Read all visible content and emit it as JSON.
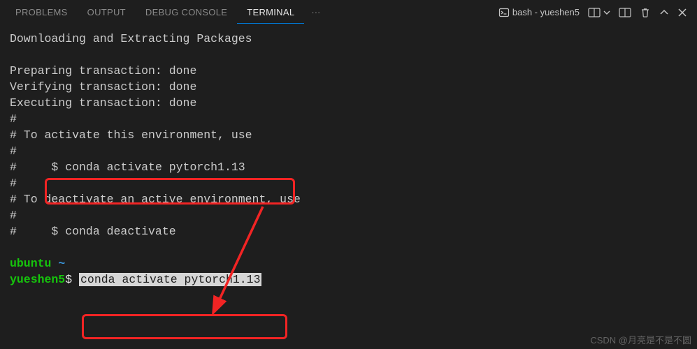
{
  "tabs": {
    "problems": "PROBLEMS",
    "output": "OUTPUT",
    "debug_console": "DEBUG CONSOLE",
    "terminal": "TERMINAL",
    "more": "···"
  },
  "toolbar": {
    "shell_label": "bash - yueshen5"
  },
  "term": {
    "l1": "Downloading and Extracting Packages",
    "l2": "",
    "l3": "Preparing transaction: done",
    "l4": "Verifying transaction: done",
    "l5": "Executing transaction: done",
    "l6": "#",
    "l7": "# To activate this environment, use",
    "l8": "#",
    "l9a": "#     ",
    "l9b": "$ conda activate pytorch1.13",
    "l10": "#",
    "l11": "# To deactivate an active environment, use",
    "l12": "#",
    "l13": "#     $ conda deactivate",
    "l14": "",
    "host1": "ubuntu",
    "path1": " ~",
    "host2": "yueshen5",
    "prompt2": "$ ",
    "cmd2": "conda activate pytorch1.13"
  },
  "watermark": "CSDN @月亮是不是不圆"
}
